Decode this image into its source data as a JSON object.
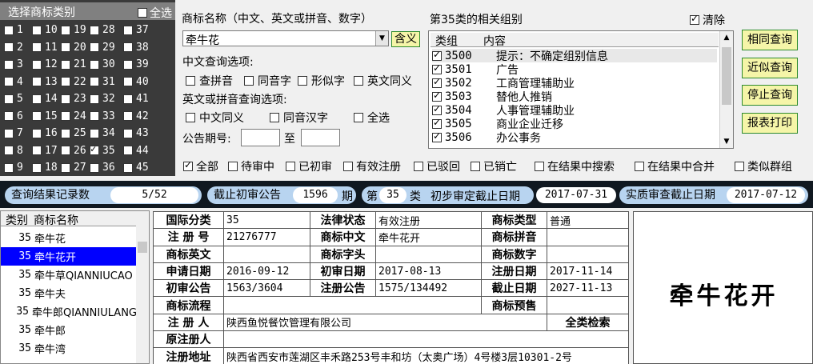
{
  "categories": {
    "title": "选择商标类别",
    "select_all": "全选",
    "numbers": [
      1,
      2,
      3,
      4,
      5,
      6,
      7,
      8,
      9,
      10,
      11,
      12,
      13,
      14,
      15,
      16,
      17,
      18,
      19,
      20,
      21,
      22,
      23,
      24,
      25,
      26,
      27,
      28,
      29,
      30,
      31,
      32,
      33,
      34,
      35,
      36,
      37,
      38,
      39,
      40,
      41,
      42,
      43,
      44,
      45
    ],
    "checked": [
      35
    ]
  },
  "query": {
    "name_label": "商标名称（中文、英文或拼音、数字）",
    "name_value": "牵牛花",
    "meaning_button": "含义",
    "cn_options_label": "中文查询选项:",
    "cn_options": [
      "查拼音",
      "同音字",
      "形似字",
      "英文同义"
    ],
    "en_options_label": "英文或拼音查询选项:",
    "en_options": [
      "中文同义",
      "同音汉字",
      "全选"
    ],
    "issue_label": "公告期号:",
    "issue_to": "至"
  },
  "groups": {
    "title": "第35类的相关组别",
    "clear_label": "清除",
    "col_group": "类组",
    "col_content": "内容",
    "rows": [
      {
        "code": "3500",
        "text": "提示：不确定组别信息"
      },
      {
        "code": "3501",
        "text": "广告"
      },
      {
        "code": "3502",
        "text": "工商管理辅助业"
      },
      {
        "code": "3503",
        "text": "替他人推销"
      },
      {
        "code": "3504",
        "text": "人事管理辅助业"
      },
      {
        "code": "3505",
        "text": "商业企业迁移"
      },
      {
        "code": "3506",
        "text": "办公事务"
      }
    ]
  },
  "actions": {
    "same": "相同查询",
    "similar": "近似查询",
    "stop": "停止查询",
    "print": "报表打印"
  },
  "filters": [
    {
      "label": "全部",
      "checked": true
    },
    {
      "label": "待审中",
      "checked": false
    },
    {
      "label": "已初审",
      "checked": false
    },
    {
      "label": "有效注册",
      "checked": false
    },
    {
      "label": "已驳回",
      "checked": false
    },
    {
      "label": "已销亡",
      "checked": false
    },
    {
      "label": "在结果中搜索",
      "checked": false
    },
    {
      "label": "在结果中合并",
      "checked": false
    },
    {
      "label": "类似群组",
      "checked": false
    }
  ],
  "summary": {
    "records_label": "查询结果记录数",
    "records_value": "5/52",
    "cutoff_label": "截止初审公告",
    "cutoff_value": "1596",
    "cutoff_unit": "期",
    "class_prefix": "第",
    "class_value": "35",
    "class_suffix": "类",
    "prelim_label": "初步审定截止日期",
    "prelim_value": "2017-07-31",
    "substantive_label": "实质审查截止日期",
    "substantive_value": "2017-07-12"
  },
  "results": {
    "col_class": "类别",
    "col_name": "商标名称",
    "rows": [
      {
        "cls": "35",
        "name": "牵牛花",
        "selected": false
      },
      {
        "cls": "35",
        "name": "牵牛花开",
        "selected": true
      },
      {
        "cls": "35",
        "name": "牵牛草QIANNIUCAO",
        "selected": false
      },
      {
        "cls": "35",
        "name": "牵牛夫",
        "selected": false
      },
      {
        "cls": "35",
        "name": "牵牛郎QIANNIULANG",
        "selected": false
      },
      {
        "cls": "35",
        "name": "牵牛郎",
        "selected": false
      },
      {
        "cls": "35",
        "name": "牵牛湾",
        "selected": false
      }
    ]
  },
  "detail": {
    "intl_class_k": "国际分类",
    "intl_class_v": "35",
    "legal_k": "法律状态",
    "legal_v": "有效注册",
    "type_k": "商标类型",
    "type_v": "普通",
    "regno_k": "注 册 号",
    "regno_v": "21276777",
    "cn_k": "商标中文",
    "cn_v": "牵牛花开",
    "pinyin_k": "商标拼音",
    "pinyin_v": "",
    "en_k": "商标英文",
    "en_v": "",
    "letter_k": "商标字头",
    "letter_v": "",
    "digit_k": "商标数字",
    "digit_v": "",
    "apply_k": "申请日期",
    "apply_v": "2016-09-12",
    "prelimdate_k": "初审日期",
    "prelimdate_v": "2017-08-13",
    "regdate_k": "注册日期",
    "regdate_v": "2017-11-14",
    "prelimpub_k": "初审公告",
    "prelimpub_v": "1563/3604",
    "regpub_k": "注册公告",
    "regpub_v": "1575/134492",
    "expire_k": "截止日期",
    "expire_v": "2027-11-13",
    "flow_k": "商标流程",
    "flow_v": "",
    "warn_k": "商标预售",
    "warn_v": "",
    "registrant_k": "注 册 人",
    "registrant_v": "陕西鱼悦餐饮管理有限公司",
    "allclass": "全类检索",
    "orig_k": "原注册人",
    "orig_v": "",
    "addr_k": "注册地址",
    "addr_v": "陕西省西安市莲湖区丰禾路253号丰和坊（太奥广场）4号楼3层10301-2号"
  },
  "trademark_image": {
    "word": "牵牛花开"
  }
}
